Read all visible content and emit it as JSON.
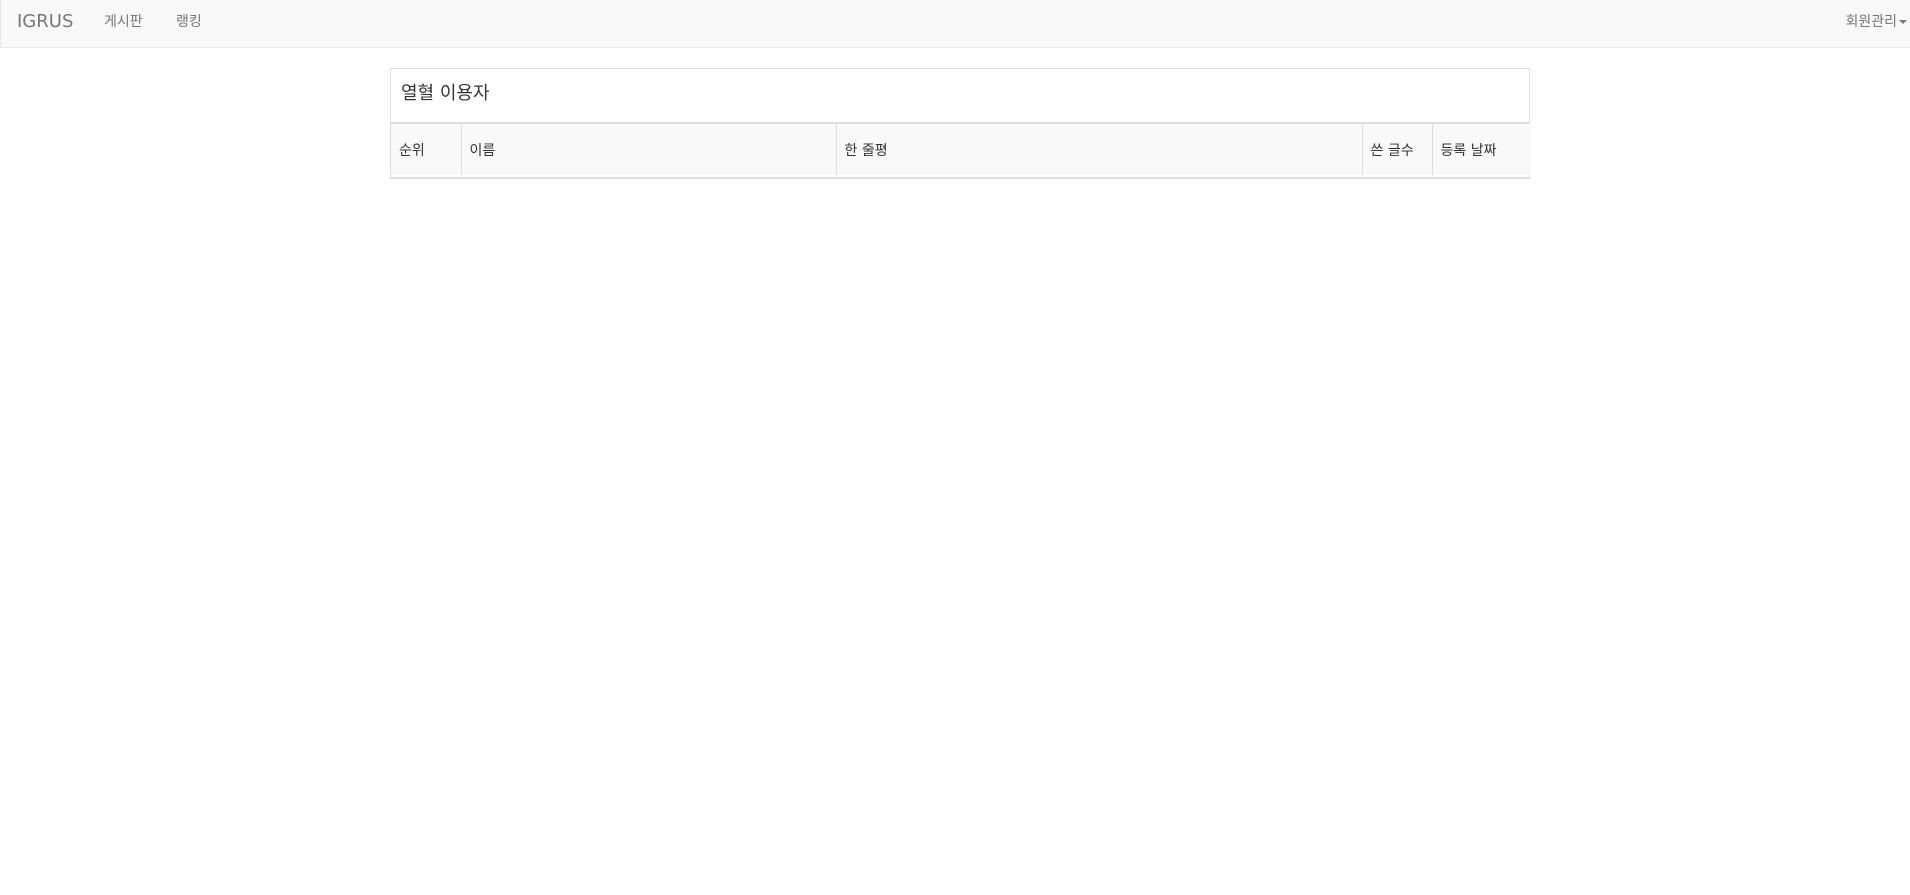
{
  "navbar": {
    "brand": "IGRUS",
    "links": [
      {
        "label": "게시판"
      },
      {
        "label": "랭킹"
      }
    ],
    "member_menu": "회원관리"
  },
  "panel": {
    "title": "열혈 이용자",
    "columns": [
      "순위",
      "이름",
      "한 줄평",
      "쓴 글수",
      "등록 날짜"
    ],
    "rows": []
  },
  "colors": {
    "navbar_bg": "#f8f8f8",
    "nav_text": "#777777",
    "border": "#dddddd",
    "table_header_bg": "#f9f9f9"
  }
}
